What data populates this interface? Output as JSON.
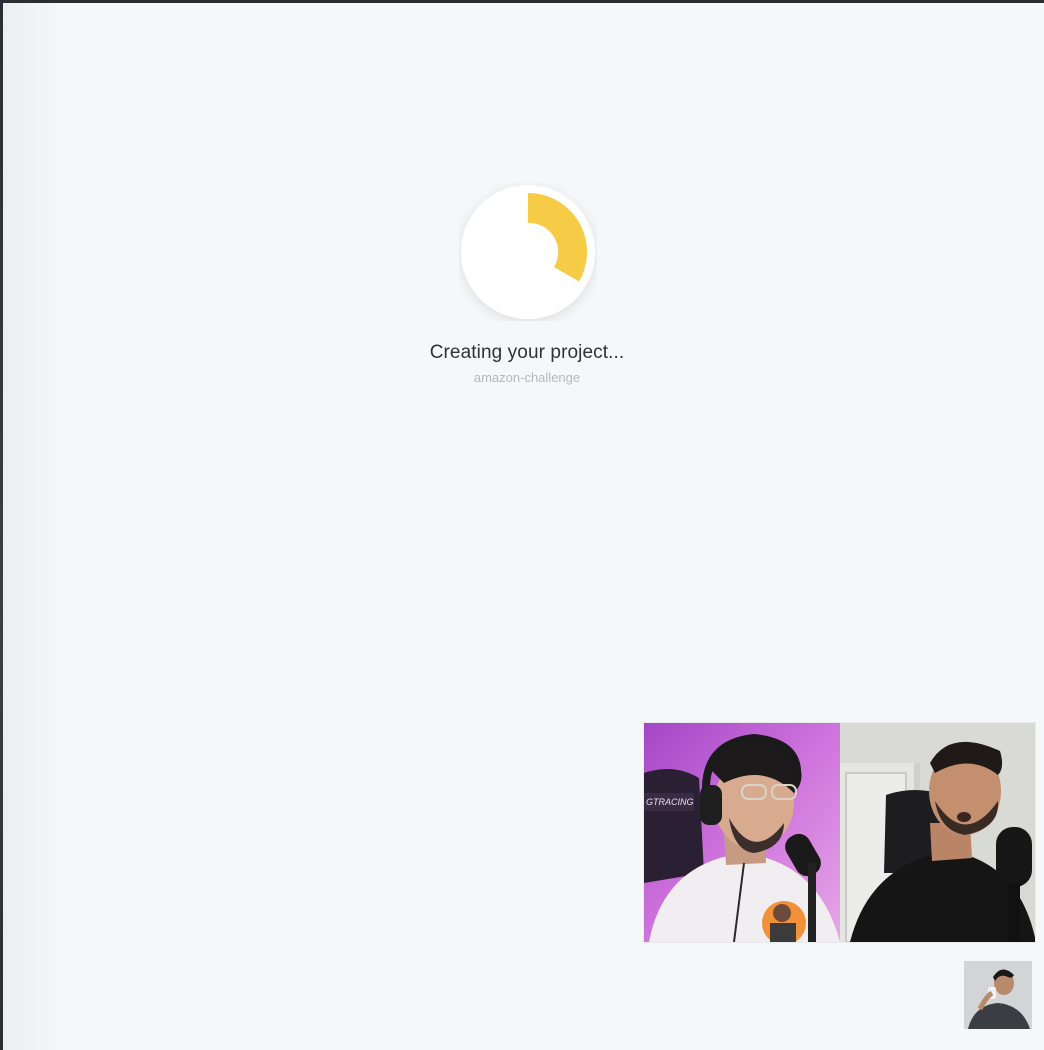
{
  "status": {
    "title": "Creating your project...",
    "project_name": "amazon-challenge"
  },
  "loader": {
    "accent_color": "#f6cb46",
    "track_color": "#ffffff"
  },
  "video": {
    "participants": [
      {
        "label": "GTRACING"
      }
    ]
  }
}
